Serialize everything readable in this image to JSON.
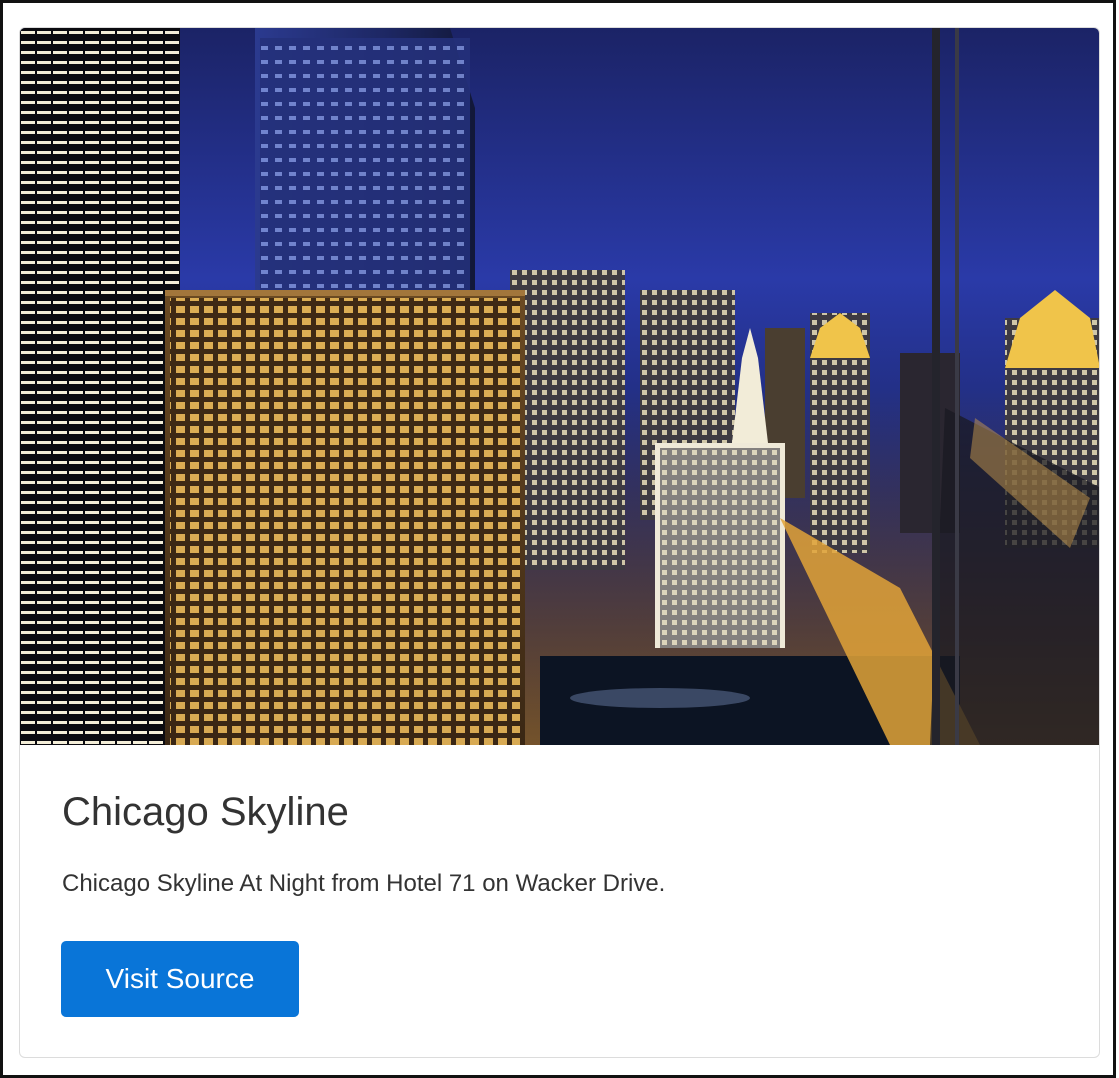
{
  "card": {
    "image_subject": "Chicago skyline at night from a high-rise balcony, river and lit skyscrapers",
    "title": "Chicago Skyline",
    "text": "Chicago Skyline At Night from Hotel 71 on Wacker Drive.",
    "button_label": "Visit Source"
  },
  "colors": {
    "button": "#0975d8",
    "title_text": "#333333",
    "card_border": "#dcdcdc"
  }
}
